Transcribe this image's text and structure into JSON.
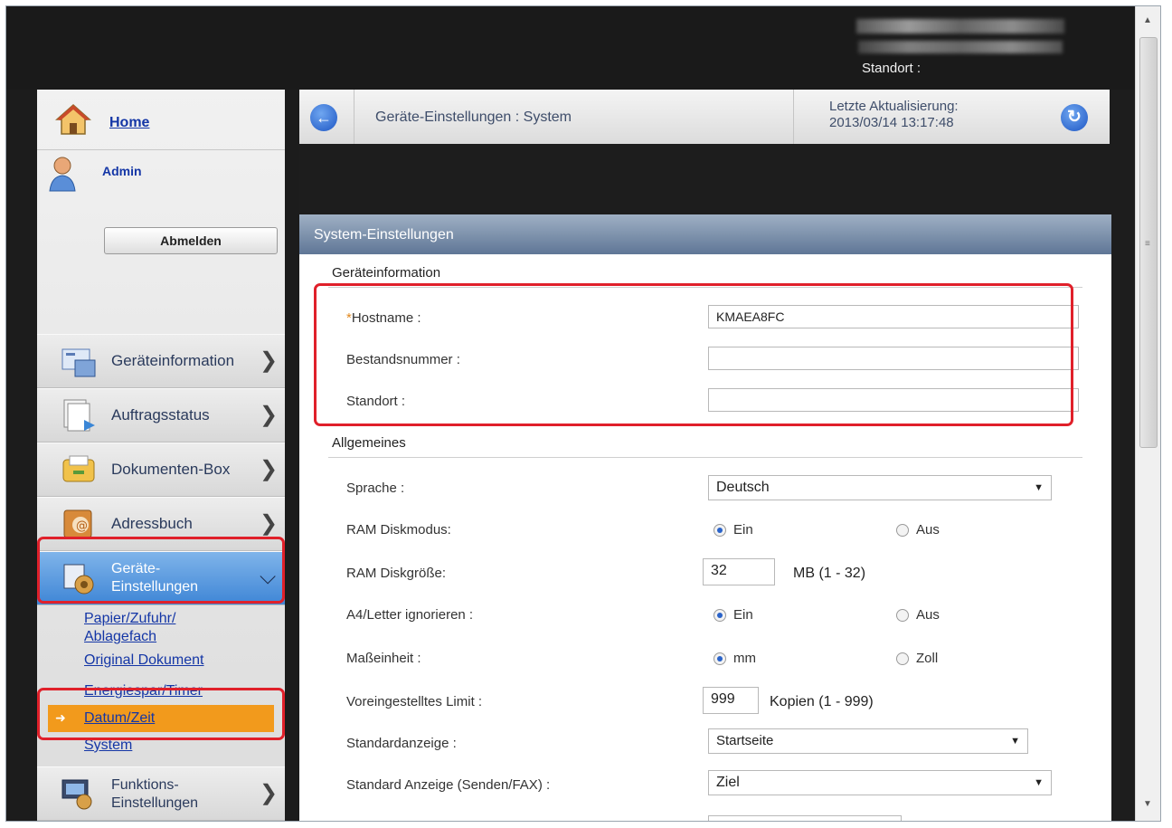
{
  "topbar": {
    "standort_label": "Standort :"
  },
  "sidebar": {
    "home": "Home",
    "user": "Admin",
    "logout": "Abmelden",
    "items": [
      {
        "label": "Geräteinformation",
        "icon": "device-info-icon"
      },
      {
        "label": "Auftragsstatus",
        "icon": "job-status-icon"
      },
      {
        "label": "Dokumenten-Box",
        "icon": "document-box-icon"
      },
      {
        "label": "Adressbuch",
        "icon": "address-book-icon"
      },
      {
        "label_line1": "Geräte-",
        "label_line2": "Einstellungen",
        "icon": "device-settings-icon",
        "active": true
      },
      {
        "label_line1": "Funktions-",
        "label_line2": "Einstellungen",
        "icon": "function-settings-icon"
      }
    ],
    "submenu": [
      "Papier/Zufuhr/",
      "Ablagefach",
      "Original Dokument",
      "Energiespar/Timer",
      "Datum/Zeit",
      "System"
    ]
  },
  "header": {
    "title": "Geräte-Einstellungen : System",
    "last_update_label": "Letzte Aktualisierung:",
    "last_update_value": "2013/03/14 13:17:48"
  },
  "panel": {
    "title": "System-Einstellungen",
    "section1": "Geräteinformation",
    "hostname_label": "Hostname :",
    "hostname_value": "KMAEA8FC",
    "asset_label": "Bestandsnummer :",
    "asset_value": "",
    "location_label": "Standort :",
    "location_value": "",
    "section2": "Allgemeines",
    "language_label": "Sprache :",
    "language_value": "Deutsch",
    "ram_mode_label": "RAM Diskmodus:",
    "ram_mode_on": "Ein",
    "ram_mode_off": "Aus",
    "ram_size_label": "RAM Diskgröße:",
    "ram_size_value": "32",
    "ram_size_unit": "MB (1 - 32)",
    "a4_label": "A4/Letter ignorieren :",
    "a4_on": "Ein",
    "a4_off": "Aus",
    "unit_label": "Maßeinheit :",
    "unit_mm": "mm",
    "unit_inch": "Zoll",
    "limit_label": "Voreingestelltes Limit :",
    "limit_value": "999",
    "limit_unit": "Kopien (1 - 999)",
    "default_screen_label": "Standardanzeige :",
    "default_screen_value": "Startseite",
    "default_send_label": "Standard Anzeige (Senden/FAX) :",
    "default_send_value": "Ziel"
  },
  "colors": {
    "highlight_border": "#e0202a",
    "active_item": "#3f86d6",
    "selected_sub": "#f29a1c",
    "link": "#1436a6"
  }
}
